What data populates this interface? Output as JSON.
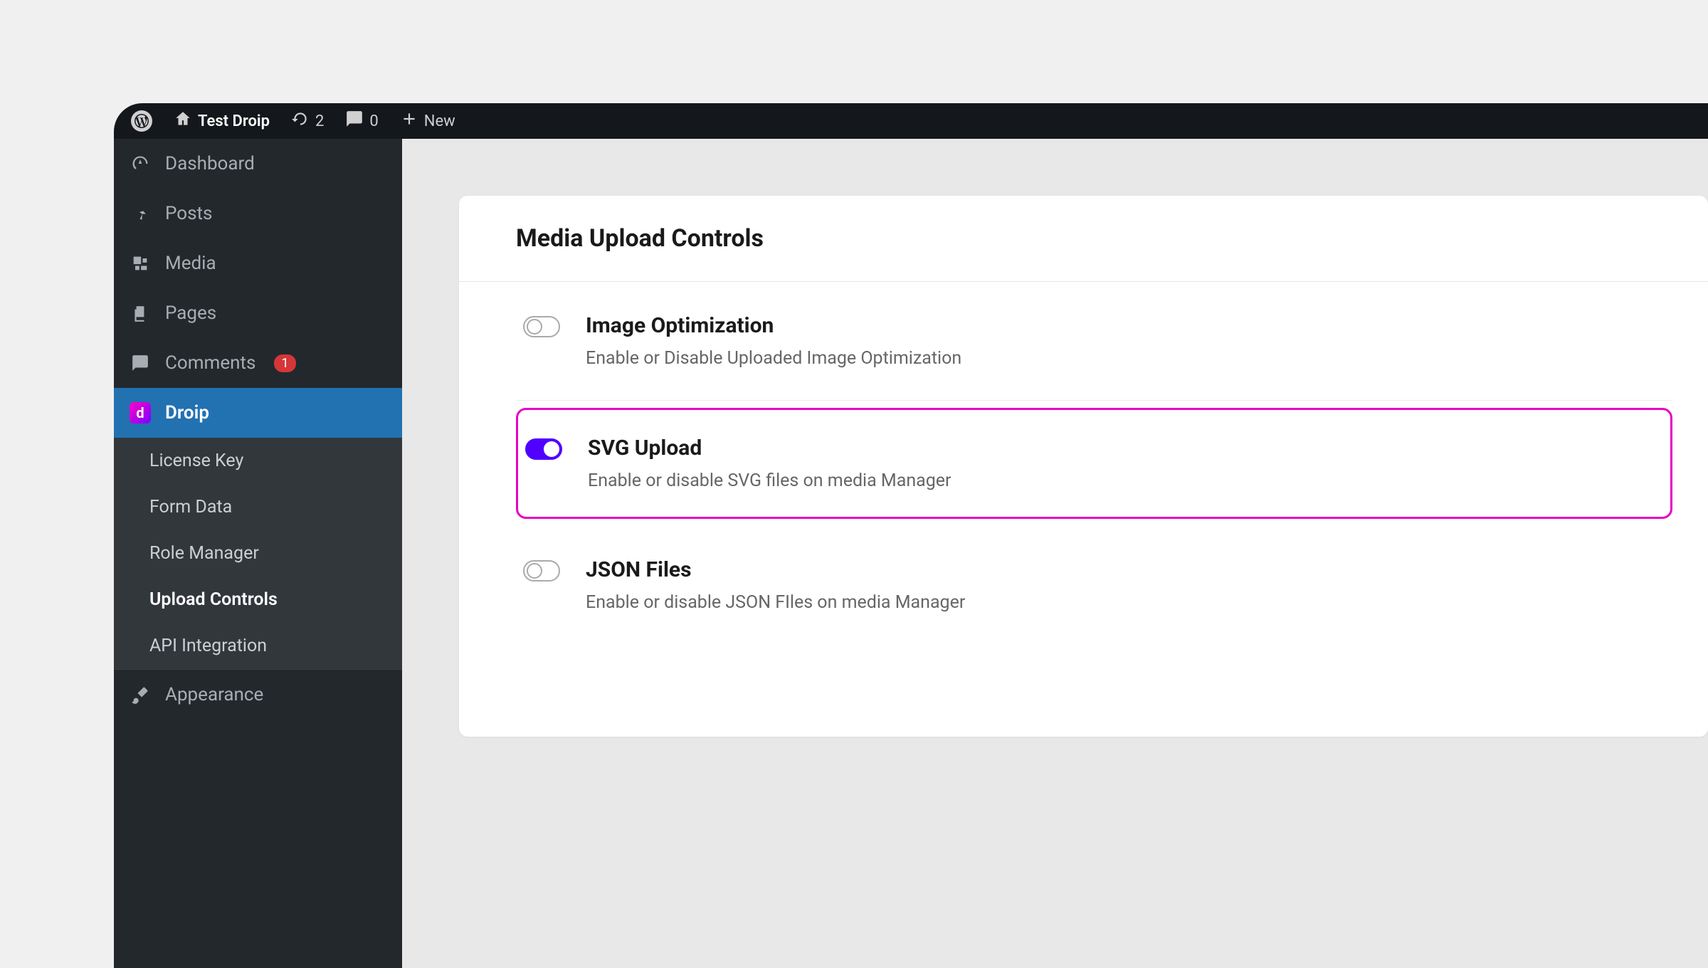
{
  "adminbar": {
    "site_name": "Test Droip",
    "updates_count": "2",
    "comments_count": "0",
    "new_label": "New"
  },
  "sidebar": {
    "items": [
      {
        "label": "Dashboard"
      },
      {
        "label": "Posts"
      },
      {
        "label": "Media"
      },
      {
        "label": "Pages"
      },
      {
        "label": "Comments",
        "badge": "1"
      },
      {
        "label": "Droip",
        "active": true
      },
      {
        "label": "Appearance"
      }
    ],
    "submenu": [
      {
        "label": "License Key"
      },
      {
        "label": "Form Data"
      },
      {
        "label": "Role Manager"
      },
      {
        "label": "Upload Controls",
        "current": true
      },
      {
        "label": "API Integration"
      }
    ]
  },
  "panel": {
    "title": "Media Upload Controls",
    "settings": [
      {
        "title": "Image Optimization",
        "desc": "Enable or Disable Uploaded Image Optimization",
        "enabled": false
      },
      {
        "title": "SVG Upload",
        "desc": "Enable or disable SVG files on media Manager",
        "enabled": true,
        "highlighted": true
      },
      {
        "title": "JSON Files",
        "desc": "Enable or disable JSON FIles on media Manager",
        "enabled": false
      }
    ]
  }
}
